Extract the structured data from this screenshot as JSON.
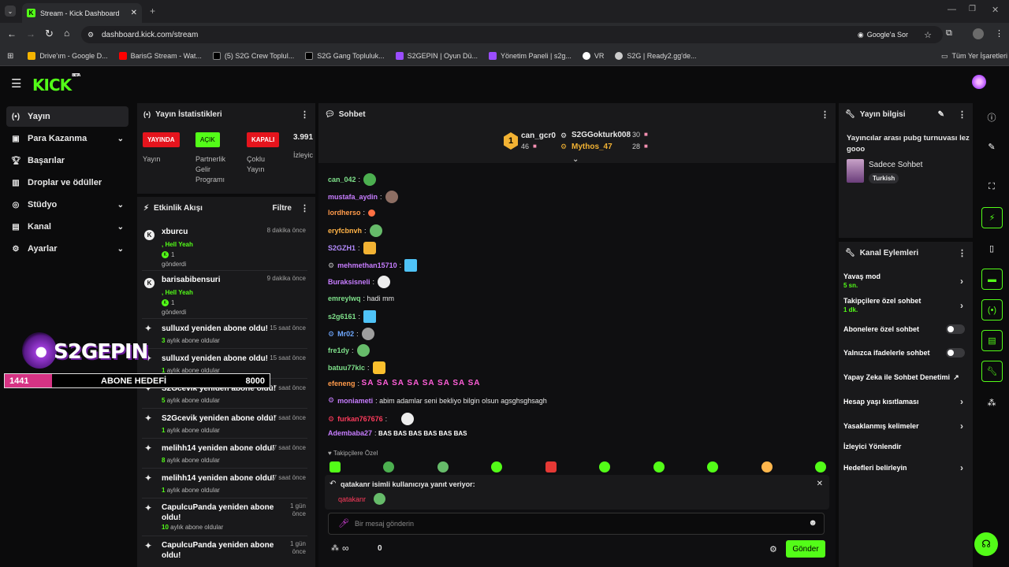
{
  "browser": {
    "tab_title": "Stream - Kick Dashboard",
    "url": "dashboard.kick.com/stream",
    "search_chip": "Google'a Sor",
    "bookmarks": [
      "Drive'ım - Google D...",
      "BarisG Stream - Wat...",
      "(5) S2G Crew Toplul...",
      "S2G Gang Topluluk...",
      "S2GEPIN | Oyun Dü...",
      "Yönetim Paneli | s2g...",
      "VR",
      "S2G | Ready2.gg'de..."
    ],
    "all_bookmarks": "Tüm Yer İşaretleri"
  },
  "brand": {
    "logo": "KICK",
    "beta": "BETA"
  },
  "sidebar": {
    "items": [
      {
        "label": "Yayın",
        "icon": "broadcast-icon"
      },
      {
        "label": "Para Kazanma",
        "icon": "money-icon"
      },
      {
        "label": "Başarılar",
        "icon": "trophy-icon"
      },
      {
        "label": "Droplar ve ödüller",
        "icon": "gift-icon"
      },
      {
        "label": "Stüdyo",
        "icon": "studio-icon"
      },
      {
        "label": "Kanal",
        "icon": "channel-icon"
      },
      {
        "label": "Ayarlar",
        "icon": "gear-icon"
      }
    ]
  },
  "overlay": {
    "brand": "S2GEPIN",
    "goal_current": "1441",
    "goal_label": "ABONE HEDEFİ",
    "goal_target": "8000",
    "goal_progress": 0.18
  },
  "stats": {
    "title": "Yayın İstatistikleri",
    "b1": "YAYINDA",
    "b1_caption": "Yayın",
    "b2": "AÇIK",
    "b2_caption_1": "Partnerlik",
    "b2_caption_2": "Gelir",
    "b2_caption_3": "Programı",
    "b3": "KAPALI",
    "b3_caption_1": "Çoklu",
    "b3_caption_2": "Yayın",
    "viewers": "3.991",
    "viewers_caption": "İzleyic"
  },
  "activity": {
    "title": "Etkinlik Akışı",
    "filter": "Filtre",
    "events": [
      {
        "name": "xburcu",
        "time": "8 dakika önce",
        "line1": ", Hell Yeah",
        "count": "1",
        "line3": "gönderdi"
      },
      {
        "name": "barisabibensuri",
        "time": "9 dakika önce",
        "line1": ", Hell Yeah",
        "count": "1",
        "line3": "gönderdi"
      },
      {
        "name": "sulluxd yeniden abone oldu!",
        "time": "15 saat önce",
        "months": "3",
        "suffix": "aylık abone oldular"
      },
      {
        "name": "sulluxd yeniden abone oldu!",
        "time": "15 saat önce",
        "months": "1",
        "suffix": "aylık abone oldular"
      },
      {
        "name": "S2Gcevik yeniden abone oldu!",
        "time": "17 saat önce",
        "months": "5",
        "suffix": "aylık abone oldular"
      },
      {
        "name": "S2Gcevik yeniden abone oldu!",
        "time": "17 saat önce",
        "months": "1",
        "suffix": "aylık abone oldular"
      },
      {
        "name": "melihh14 yeniden abone oldu!",
        "time": "17 saat önce",
        "months": "8",
        "suffix": "aylık abone oldular"
      },
      {
        "name": "melihh14 yeniden abone oldu!",
        "time": "17 saat önce",
        "months": "1",
        "suffix": "aylık abone oldular"
      },
      {
        "name1": "CapulcuPanda yeniden abone",
        "name2": "oldu!",
        "time1": "1 gün",
        "time2": "önce",
        "months": "10",
        "suffix": "aylık abone oldular"
      },
      {
        "name1": "CapulcuPanda yeniden abone",
        "name2": "oldu!",
        "time1": "1 gün",
        "time2": "önce"
      }
    ]
  },
  "chat": {
    "title": "Sohbet",
    "leaders": [
      {
        "rank": "1",
        "name": "can_gcr0",
        "count": "46"
      },
      {
        "name": "S2GGokturk008",
        "count": "30"
      },
      {
        "name": "Mythos_47",
        "count": "28"
      }
    ],
    "messages": [
      {
        "user": "can_042",
        "color": "#7ee08a",
        "text": ""
      },
      {
        "user": "mustafa_aydin",
        "color": "#c77dff",
        "text": ""
      },
      {
        "user": "lordherso",
        "color": "#ff9a4a",
        "text": ""
      },
      {
        "user": "eryfcbnvh",
        "color": "#ffb347",
        "text": ""
      },
      {
        "user": "S2GZH1",
        "color": "#b58cff",
        "text": ""
      },
      {
        "user": "mehmethan15710",
        "color": "#c77dff",
        "text": ""
      },
      {
        "user": "Buraksisneli",
        "color": "#c77dff",
        "text": ""
      },
      {
        "user": "emreylwq",
        "color": "#7ee08a",
        "text": "hadi mm"
      },
      {
        "user": "s2g6161",
        "color": "#7ee08a",
        "text": ""
      },
      {
        "user": "Mr02",
        "color": "#6fa8ff",
        "text": ""
      },
      {
        "user": "fre1dy",
        "color": "#7ee08a",
        "text": ""
      },
      {
        "user": "batuu77klc",
        "color": "#7ee08a",
        "text": ""
      },
      {
        "user": "efeneng",
        "color": "#ff9a4a",
        "text": "SA SA SA SA SA SA SA SA"
      },
      {
        "user": "moniameti",
        "color": "#c77dff",
        "text": "abim adamlar seni bekliyo bilgin olsun agsghsghsagh"
      },
      {
        "user": "furkan767676",
        "color": "#ff3b5c",
        "text": ""
      },
      {
        "user": "Adembaba27",
        "color": "#c77dff",
        "text": "BAS BAS BAS BAS BAS BAS"
      }
    ],
    "followers_only": "Takipçilere Özel",
    "reply_to": "qatakanr isimli kullanıcıya yanıt veriyor:",
    "reply_user": "qatakanr",
    "input_placeholder": "Bir mesaj gönderin",
    "points": "∞",
    "count": "0",
    "send": "Gönder"
  },
  "stream_info": {
    "title": "Yayın bilgisi",
    "stream_title": "Yayıncılar arası pubg turnuvası lez gooo",
    "category": "Sadece Sohbet",
    "language": "Turkish"
  },
  "channel_actions": {
    "title": "Kanal Eylemleri",
    "slow": "Yavaş mod",
    "slow_val": "5 sn.",
    "followers": "Takipçilere özel sohbet",
    "followers_val": "1 dk.",
    "subs": "Abonelere özel sohbet",
    "emotes": "Yalnızca ifadelerle sohbet",
    "ai": "Yapay Zeka ile Sohbet Denetimi",
    "age": "Hesap yaşı kısıtlaması",
    "banned": "Yasaklanmış kelimeler",
    "redirect": "İzleyici Yönlendir",
    "goals": "Hedefleri belirleyin"
  },
  "colors": {
    "accent": "#53fc18",
    "panel": "#19191b",
    "bg": "#0b0b0c"
  }
}
